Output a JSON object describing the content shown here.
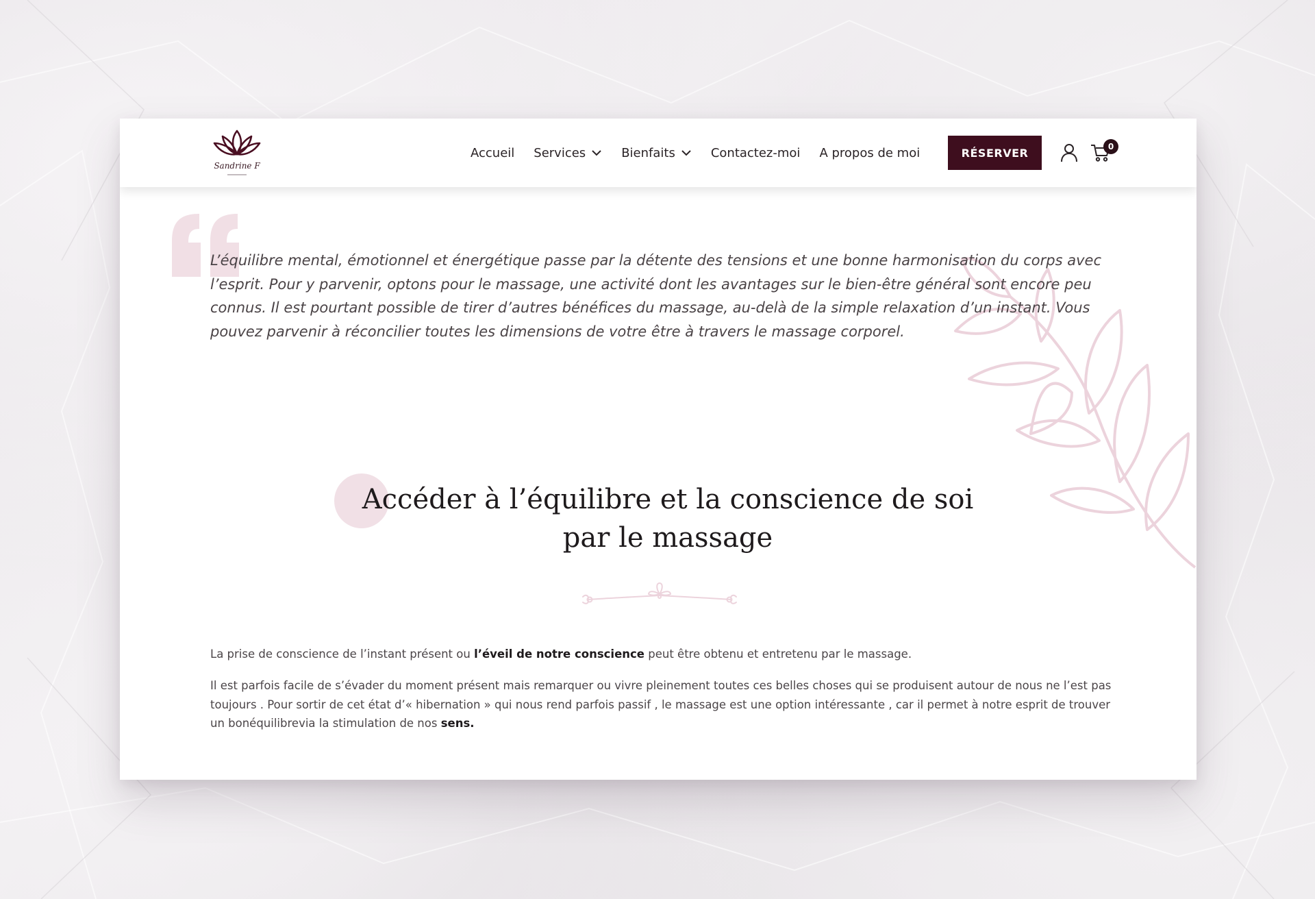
{
  "header": {
    "logo_text": "Sandrine F",
    "nav": [
      {
        "label": "Accueil",
        "dropdown": false
      },
      {
        "label": "Services",
        "dropdown": true
      },
      {
        "label": "Bienfaits",
        "dropdown": true
      },
      {
        "label": "Contactez-moi",
        "dropdown": false
      },
      {
        "label": "A propos de moi",
        "dropdown": false
      }
    ],
    "reserve_label": "RÉSERVER",
    "cart_count": "0"
  },
  "quote": {
    "text": "L’équilibre mental, émotionnel et énergétique passe par la détente des tensions et une bonne harmonisation du corps avec l’esprit. Pour y parvenir, optons pour le massage, une activité dont les avantages sur le bien-être général sont encore peu connus. Il est pourtant possible de tirer d’autres bénéfices du massage, au-delà de la simple relaxation d’un instant. Vous pouvez parvenir à réconcilier toutes les dimensions de votre être à travers le massage corporel."
  },
  "section": {
    "title_line1": "Accéder à l’équilibre et la conscience de soi",
    "title_line2": "par le massage",
    "p1_before": "La prise de conscience de l’instant présent ou ",
    "p1_bold": "l’éveil de notre conscience",
    "p1_after": " peut être obtenu et entretenu par le massage.",
    "p2_text": "Il est parfois facile de s’évader du moment présent mais remarquer ou vivre pleinement toutes ces belles choses qui se produisent autour de nous ne l’est pas toujours . Pour sortir de cet état d’« hibernation » qui nous rend parfois passif , le massage est une option intéressante , car il permet à notre esprit de trouver un bonéquilibrevia la stimulation de nos ",
    "p2_bold": "sens."
  },
  "colors": {
    "brand": "#3e0e1e",
    "accent_pink": "#f1e0e6",
    "text": "#4a4346"
  },
  "icons": [
    "lotus-logo-icon",
    "chevron-down-icon",
    "user-icon",
    "cart-icon",
    "quote-mark-icon",
    "leaf-branch-icon",
    "ornament-divider-icon"
  ]
}
